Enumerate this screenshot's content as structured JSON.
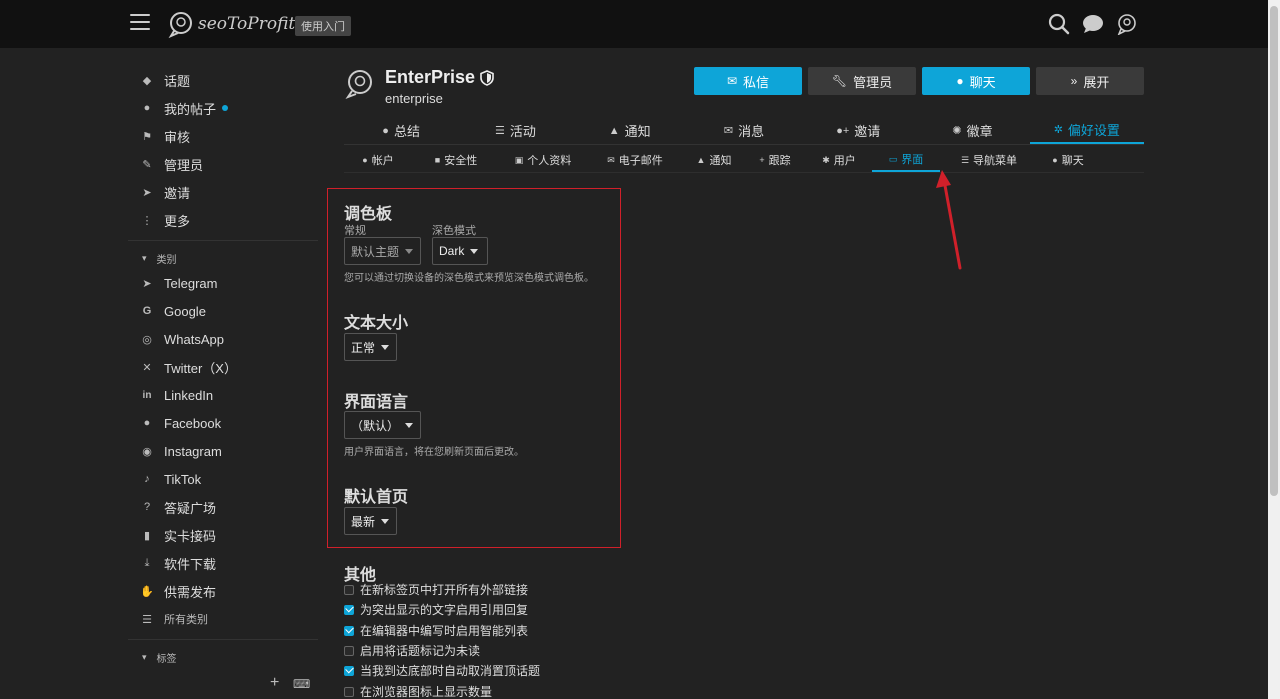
{
  "header": {
    "logo_text": "seoToProfit",
    "tag": "使用入门",
    "icons": [
      "menu-icon",
      "search-icon",
      "chat-icon",
      "avatar-icon"
    ]
  },
  "sidebar": {
    "items": [
      {
        "label": "话题",
        "icon": "layers-icon"
      },
      {
        "label": "我的帖子",
        "icon": "user-icon",
        "has_dot": true
      },
      {
        "label": "审核",
        "icon": "flag-icon"
      },
      {
        "label": "管理员",
        "icon": "wrench-icon"
      },
      {
        "label": "邀请",
        "icon": "send-icon"
      },
      {
        "label": "更多",
        "icon": "ellipsis-icon"
      }
    ],
    "categories_title": "类别",
    "categories": [
      {
        "label": "Telegram",
        "icon": "telegram-icon"
      },
      {
        "label": "Google",
        "icon": "google-icon"
      },
      {
        "label": "WhatsApp",
        "icon": "whatsapp-icon"
      },
      {
        "label": "Twitter（X）",
        "icon": "x-icon"
      },
      {
        "label": "LinkedIn",
        "icon": "linkedin-icon"
      },
      {
        "label": "Facebook",
        "icon": "facebook-icon"
      },
      {
        "label": "Instagram",
        "icon": "instagram-icon"
      },
      {
        "label": "TikTok",
        "icon": "tiktok-icon"
      },
      {
        "label": "答疑广场",
        "icon": "question-icon"
      },
      {
        "label": "实卡接码",
        "icon": "sim-icon"
      },
      {
        "label": "软件下载",
        "icon": "download-icon"
      },
      {
        "label": "供需发布",
        "icon": "handshake-icon"
      }
    ],
    "all_categories": "所有类别",
    "tags_title": "标签"
  },
  "profile": {
    "name": "EnterPrise",
    "username": "enterprise",
    "buttons": [
      {
        "label": "私信",
        "icon": "mail-icon",
        "style": "blue"
      },
      {
        "label": "管理员",
        "icon": "wrench-icon",
        "style": "gray"
      },
      {
        "label": "聊天",
        "icon": "chat-icon",
        "style": "blue"
      },
      {
        "label": "展开",
        "icon": "double-chevron-icon",
        "style": "gray"
      }
    ]
  },
  "tabs": [
    {
      "label": "总结",
      "icon": "user-icon"
    },
    {
      "label": "活动",
      "icon": "list-icon"
    },
    {
      "label": "通知",
      "icon": "bell-icon"
    },
    {
      "label": "消息",
      "icon": "mail-icon"
    },
    {
      "label": "邀请",
      "icon": "user-plus-icon"
    },
    {
      "label": "徽章",
      "icon": "badge-icon"
    },
    {
      "label": "偏好设置",
      "icon": "gear-icon",
      "active": true
    }
  ],
  "subtabs": [
    {
      "label": "帐户",
      "icon": "user-circle-icon"
    },
    {
      "label": "安全性",
      "icon": "lock-icon"
    },
    {
      "label": "个人资料",
      "icon": "id-card-icon"
    },
    {
      "label": "电子邮件",
      "icon": "mail-icon"
    },
    {
      "label": "通知",
      "icon": "bell-icon"
    },
    {
      "label": "跟踪",
      "icon": "plus-icon"
    },
    {
      "label": "用户",
      "icon": "users-icon"
    },
    {
      "label": "界面",
      "icon": "desktop-icon",
      "active": true
    },
    {
      "label": "导航菜单",
      "icon": "bars-icon"
    },
    {
      "label": "聊天",
      "icon": "chat-icon"
    }
  ],
  "interface": {
    "palette": {
      "title": "调色板",
      "regular_label": "常规",
      "regular_value": "默认主题",
      "dark_label": "深色模式",
      "dark_value": "Dark",
      "hint": "您可以通过切换设备的深色模式来预览深色模式调色板。"
    },
    "text_size": {
      "title": "文本大小",
      "value": "正常"
    },
    "language": {
      "title": "界面语言",
      "value": "（默认）",
      "hint": "用户界面语言，将在您刷新页面后更改。"
    },
    "homepage": {
      "title": "默认首页",
      "value": "最新"
    },
    "other": {
      "title": "其他",
      "options": [
        {
          "label": "在新标签页中打开所有外部链接",
          "checked": false
        },
        {
          "label": "为突出显示的文字启用引用回复",
          "checked": true
        },
        {
          "label": "在编辑器中编写时启用智能列表",
          "checked": true
        },
        {
          "label": "启用将话题标记为未读",
          "checked": false
        },
        {
          "label": "当我到达底部时自动取消置顶话题",
          "checked": true
        },
        {
          "label": "在浏览器图标上显示数量",
          "checked": false
        }
      ]
    }
  },
  "colors": {
    "accent": "#0ea5d8",
    "annotation": "#d0202a",
    "background": "#222222",
    "header": "#111111"
  }
}
